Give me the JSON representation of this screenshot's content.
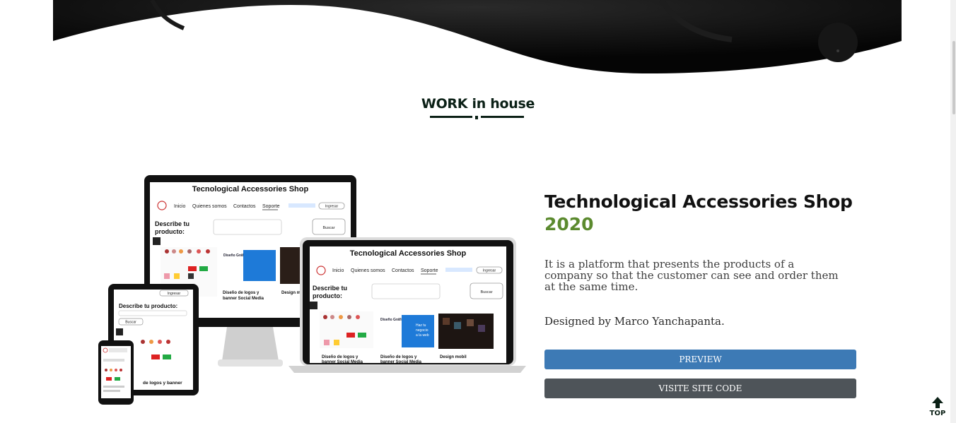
{
  "section": {
    "title": "WORK in house"
  },
  "project": {
    "title": "Technological Accessories Shop",
    "year": "2020",
    "description": "It is a platform that presents the products of a company so that the customer can see and order them at the same time.",
    "credit": "Designed by Marco Yanchapanta.",
    "preview_label": "PREVIEW",
    "code_label": "VISITE SITE CODE"
  },
  "mockup": {
    "shop_title": "Tecnological Accessories Shop",
    "nav": [
      "Inicio",
      "Quienes somos",
      "Contactos",
      "Soporte"
    ],
    "login_label": "Ingresar",
    "describe_label_1": "Describe tu",
    "describe_label_2": "producto:",
    "describe_full": "Describe tu producto:",
    "search_label": "Buscar",
    "card1_label_1": "Diseño de logos y",
    "card1_label_2": "banner Social Media",
    "card2_label": "Design mobil",
    "card3_label": "de logos y banner",
    "banner_heading": "Diseño Gráfico",
    "banner_cta_1": "Haz tu",
    "banner_cta_2": "negocio",
    "banner_cta_3": "a la web"
  },
  "to_top": {
    "label": "TOP"
  },
  "colors": {
    "accent_green": "#5b8a2e",
    "preview_blue": "#3d7ab5",
    "code_gray": "#4e5459",
    "heading_dark": "#0b2016"
  }
}
